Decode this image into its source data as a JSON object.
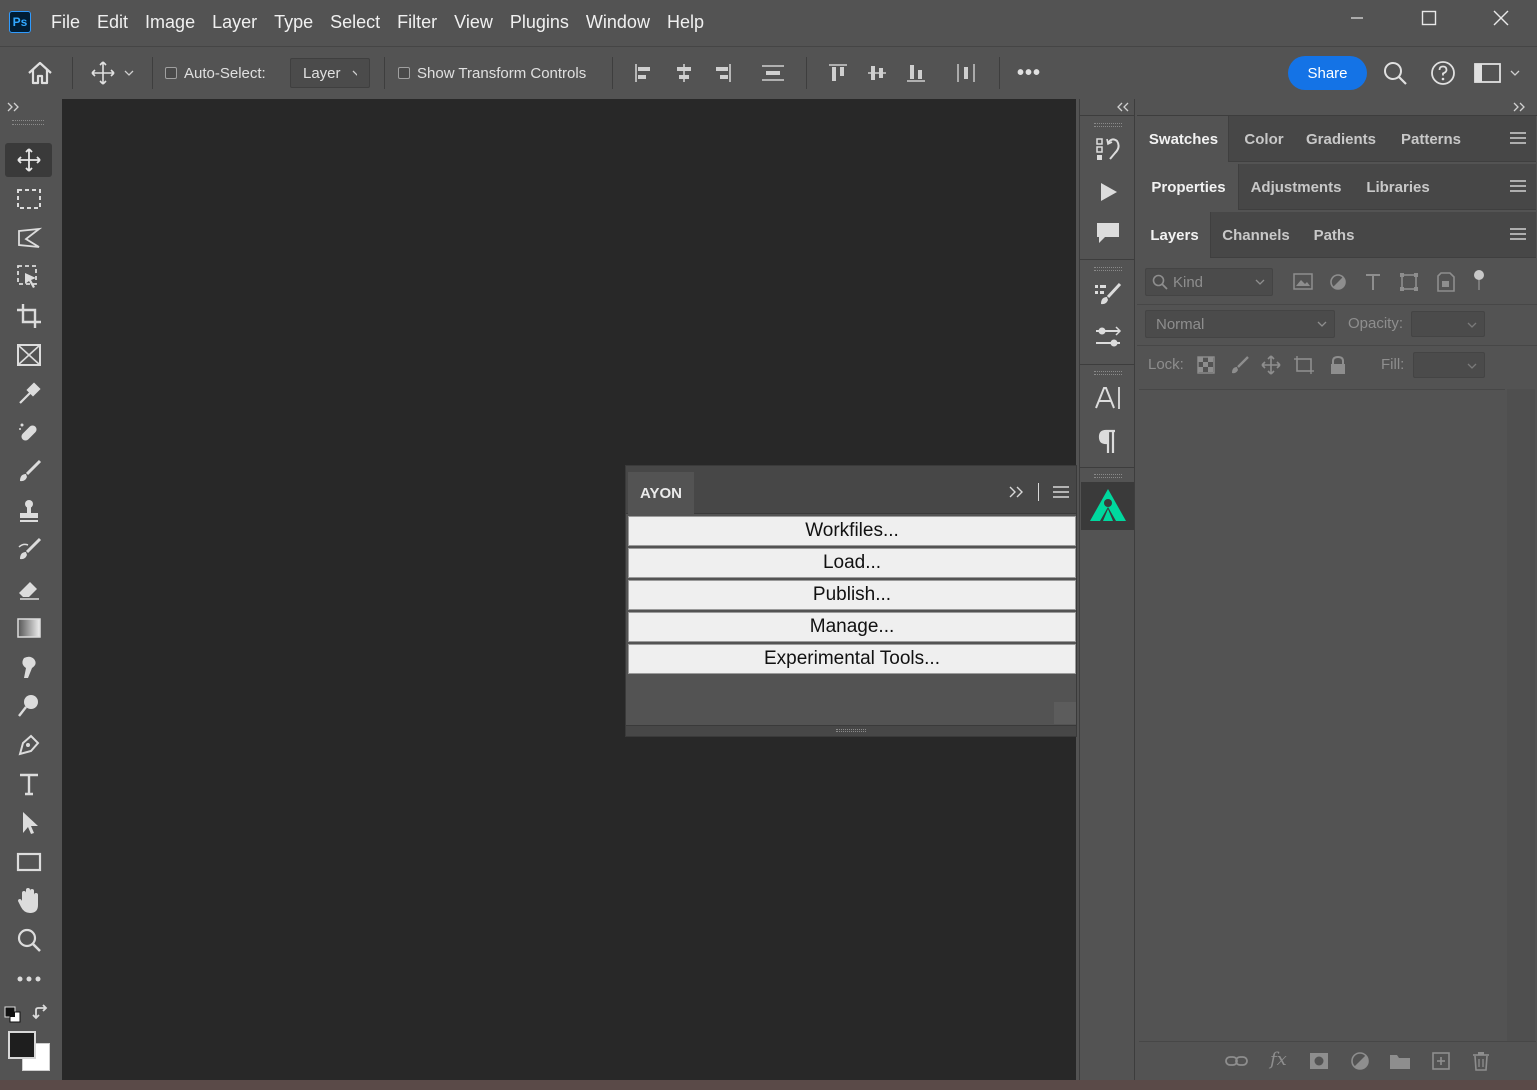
{
  "app": {
    "logo": "Ps"
  },
  "menu": [
    "File",
    "Edit",
    "Image",
    "Layer",
    "Type",
    "Select",
    "Filter",
    "View",
    "Plugins",
    "Window",
    "Help"
  ],
  "options_bar": {
    "auto_select_label": "Auto-Select:",
    "auto_select_target": "Layer",
    "show_transform_label": "Show Transform Controls",
    "more": "•••",
    "share_label": "Share"
  },
  "tools": [
    "move-tool-icon",
    "marquee-tool-icon",
    "lasso-tool-icon",
    "object-selection-tool-icon",
    "crop-tool-icon",
    "frame-tool-icon",
    "eyedropper-tool-icon",
    "healing-brush-icon",
    "brush-tool-icon",
    "clone-stamp-icon",
    "history-brush-icon",
    "eraser-tool-icon",
    "gradient-tool-icon",
    "smudge-tool-icon",
    "dodge-tool-icon",
    "pen-tool-icon",
    "type-tool-icon",
    "path-selection-icon",
    "rectangle-tool-icon",
    "hand-tool-icon",
    "zoom-tool-icon",
    "more-tools-icon"
  ],
  "right_panels": {
    "group1_tabs": [
      "Swatches",
      "Color",
      "Gradients",
      "Patterns"
    ],
    "group2_tabs": [
      "Properties",
      "Adjustments",
      "Libraries"
    ],
    "group3_tabs": [
      "Layers",
      "Channels",
      "Paths"
    ],
    "layers": {
      "filter_placeholder": "Kind",
      "blend_mode": "Normal",
      "opacity_label": "Opacity:",
      "lock_label": "Lock:",
      "fill_label": "Fill:"
    }
  },
  "ayon_panel": {
    "tab_label": "AYON",
    "buttons": [
      "Workfiles...",
      "Load...",
      "Publish...",
      "Manage...",
      "Experimental Tools..."
    ]
  },
  "colors": {
    "share_button": "#1473e6",
    "ayon_logo": "#00d89e",
    "canvas_bg": "#282828",
    "ui_bg": "#535353"
  }
}
